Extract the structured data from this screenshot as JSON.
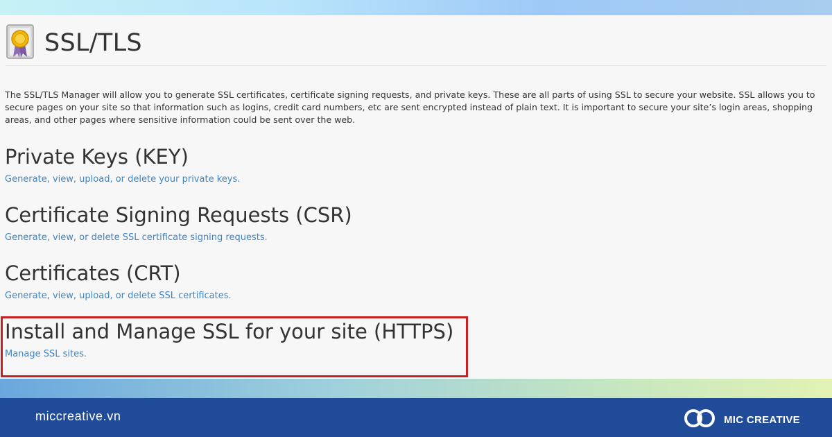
{
  "page": {
    "title": "SSL/TLS",
    "intro": "The SSL/TLS Manager will allow you to generate SSL certificates, certificate signing requests, and private keys. These are all parts of using SSL to secure your website. SSL allows you to secure pages on your site so that information such as logins, credit card numbers, etc are sent encrypted instead of plain text. It is important to secure your site’s login areas, shopping areas, and other pages where sensitive information could be sent over the web."
  },
  "sections": [
    {
      "heading": "Private Keys (KEY)",
      "link": "Generate, view, upload, or delete your private keys."
    },
    {
      "heading": "Certificate Signing Requests (CSR)",
      "link": "Generate, view, or delete SSL certificate signing requests."
    },
    {
      "heading": "Certificates (CRT)",
      "link": "Generate, view, upload, or delete SSL certificates."
    },
    {
      "heading": "Install and Manage SSL for your site (HTTPS)",
      "link": "Manage SSL sites."
    }
  ],
  "footer": {
    "url": "miccreative.vn",
    "brand": "MIC CREATIVE"
  },
  "colors": {
    "link": "#3f84c2",
    "highlight": "#c82022",
    "footer_bg": "#1f4b99"
  },
  "icons": [
    "ssl-certificate-icon",
    "mic-creative-logo-icon"
  ]
}
